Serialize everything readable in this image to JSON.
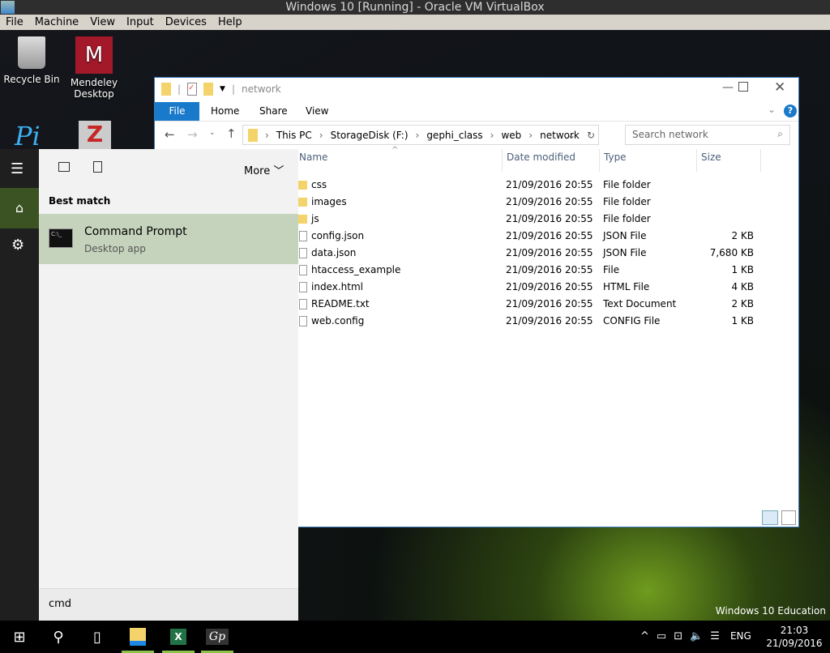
{
  "vbox": {
    "title": "Windows 10 [Running] - Oracle VM VirtualBox",
    "menu": [
      "File",
      "Machine",
      "View",
      "Input",
      "Devices",
      "Help"
    ]
  },
  "desktop": {
    "icons": [
      {
        "label": "Recycle Bin",
        "icon": "recycle-bin-icon"
      },
      {
        "label": "Mendeley Desktop",
        "icon": "mendeley-icon"
      }
    ],
    "watermark": "Windows 10 Education"
  },
  "explorer": {
    "title": "network",
    "tabs": [
      "File",
      "Home",
      "Share",
      "View"
    ],
    "breadcrumb": [
      "This PC",
      "StorageDisk (F:)",
      "gephi_class",
      "web",
      "network"
    ],
    "search_placeholder": "Search network",
    "columns": [
      "Name",
      "Date modified",
      "Type",
      "Size"
    ],
    "files": [
      {
        "name": "css",
        "date": "21/09/2016 20:55",
        "type": "File folder",
        "size": "",
        "icon": "folder-icon"
      },
      {
        "name": "images",
        "date": "21/09/2016 20:55",
        "type": "File folder",
        "size": "",
        "icon": "folder-icon"
      },
      {
        "name": "js",
        "date": "21/09/2016 20:55",
        "type": "File folder",
        "size": "",
        "icon": "folder-icon"
      },
      {
        "name": "config.json",
        "date": "21/09/2016 20:55",
        "type": "JSON File",
        "size": "2 KB",
        "icon": "file-icon"
      },
      {
        "name": "data.json",
        "date": "21/09/2016 20:55",
        "type": "JSON File",
        "size": "7,680 KB",
        "icon": "file-icon"
      },
      {
        "name": "htaccess_example",
        "date": "21/09/2016 20:55",
        "type": "File",
        "size": "1 KB",
        "icon": "file-icon"
      },
      {
        "name": "index.html",
        "date": "21/09/2016 20:55",
        "type": "HTML File",
        "size": "4 KB",
        "icon": "html-file-icon"
      },
      {
        "name": "README.txt",
        "date": "21/09/2016 20:55",
        "type": "Text Document",
        "size": "2 KB",
        "icon": "text-file-icon"
      },
      {
        "name": "web.config",
        "date": "21/09/2016 20:55",
        "type": "CONFIG File",
        "size": "1 KB",
        "icon": "file-icon"
      }
    ]
  },
  "start": {
    "more": "More",
    "best_match": "Best match",
    "result_title": "Command Prompt",
    "result_sub": "Desktop app",
    "search_value": "cmd"
  },
  "taskbar": {
    "lang": "ENG",
    "time": "21:03",
    "date": "21/09/2016"
  },
  "colors": {
    "accent": "#1979ca",
    "selected": "#c5d3bc"
  }
}
